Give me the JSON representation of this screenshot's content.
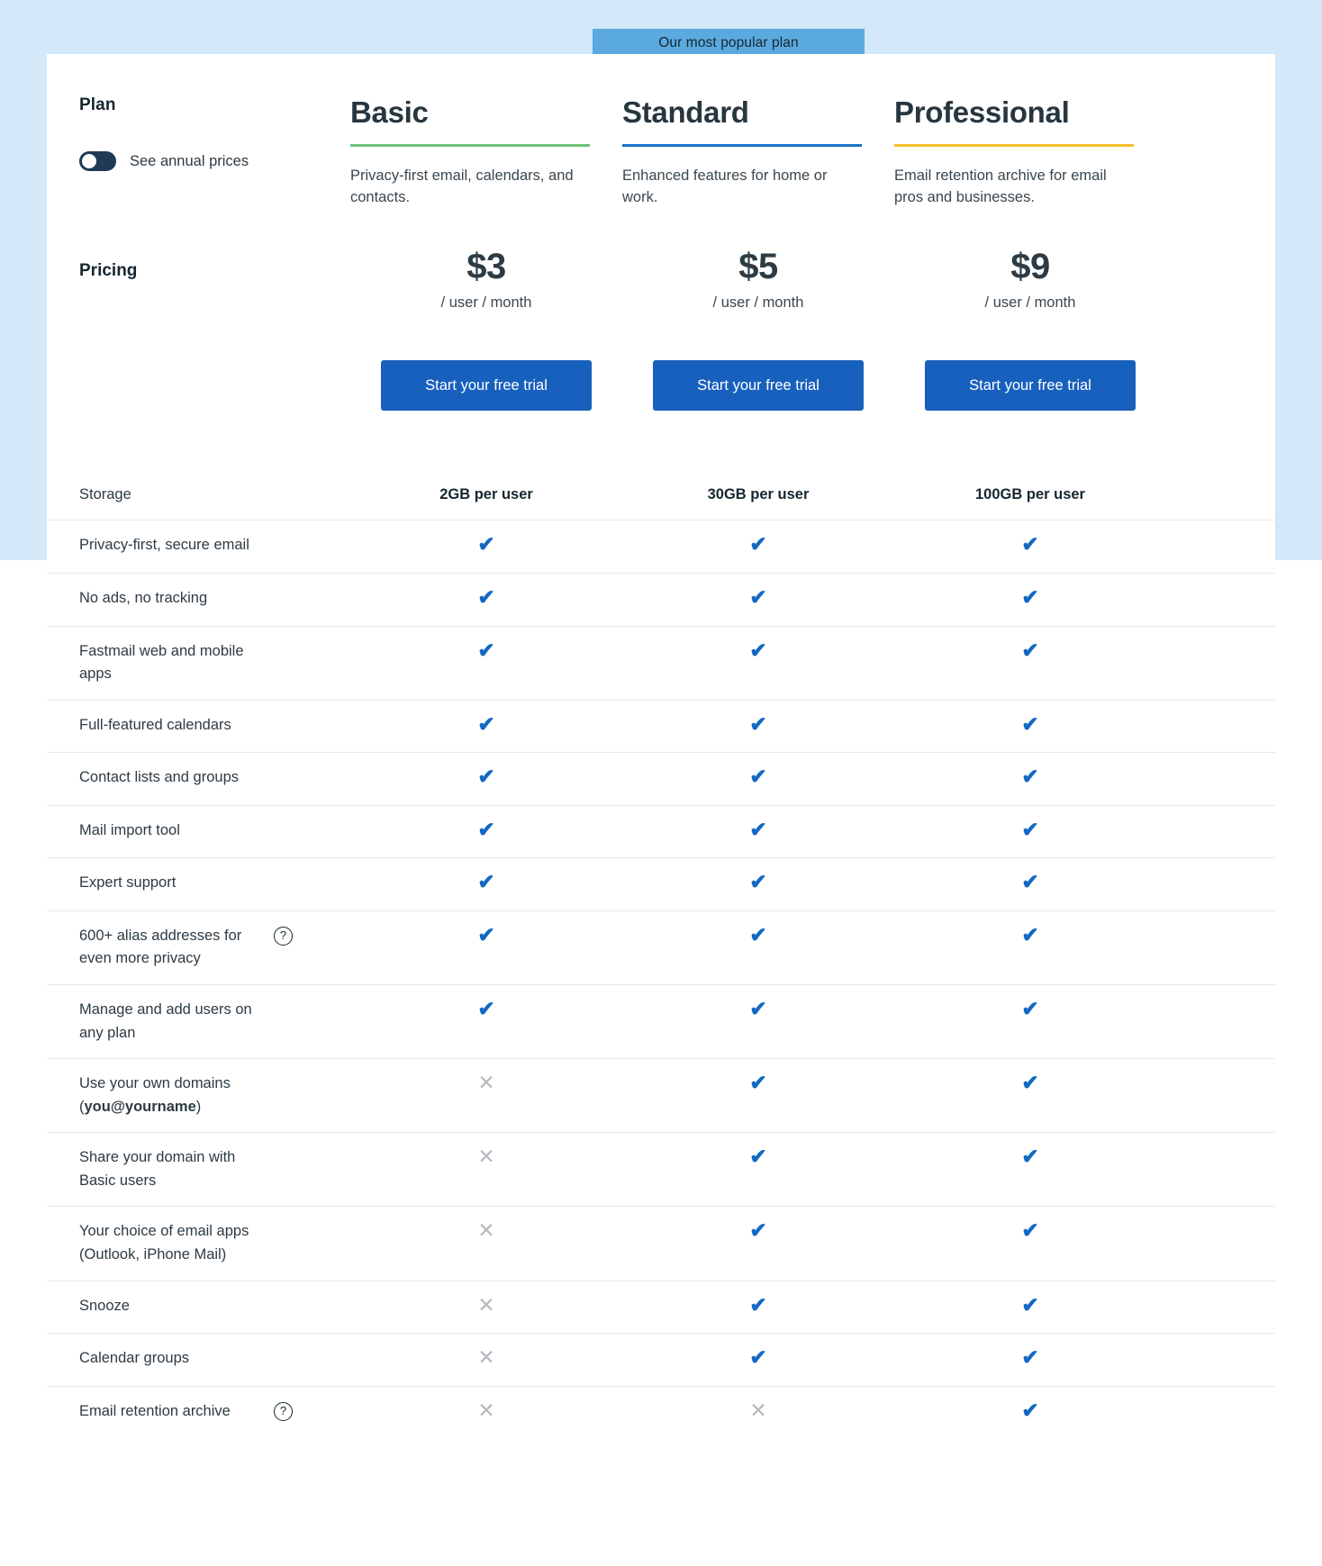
{
  "banner": {
    "text": "Our most popular plan"
  },
  "sidebar": {
    "plan_title": "Plan",
    "toggle_label": "See annual prices",
    "toggle_state": "off",
    "pricing_title": "Pricing"
  },
  "plans": [
    {
      "name": "Basic",
      "accent": "#6ec17a",
      "description": "Privacy-first email, calendars, and contacts.",
      "price": "$3",
      "price_unit": "/ user / month",
      "cta": "Start your free trial",
      "storage": "2GB per user"
    },
    {
      "name": "Standard",
      "accent": "#1a73c7",
      "description": "Enhanced features for home or work.",
      "price": "$5",
      "price_unit": "/ user / month",
      "cta": "Start your free trial",
      "storage": "30GB per user"
    },
    {
      "name": "Professional",
      "accent": "#f5c02b",
      "description": "Email retention archive for email pros and businesses.",
      "price": "$9",
      "price_unit": "/ user / month",
      "cta": "Start your free trial",
      "storage": "100GB per user"
    }
  ],
  "table": {
    "storage_label": "Storage",
    "rows": [
      {
        "label": "Privacy-first, secure email",
        "help": false,
        "values": [
          "check",
          "check",
          "check"
        ]
      },
      {
        "label": "No ads, no tracking",
        "help": false,
        "values": [
          "check",
          "check",
          "check"
        ]
      },
      {
        "label": "Fastmail web and mobile apps",
        "help": false,
        "values": [
          "check",
          "check",
          "check"
        ]
      },
      {
        "label": "Full-featured calendars",
        "help": false,
        "values": [
          "check",
          "check",
          "check"
        ]
      },
      {
        "label": "Contact lists and groups",
        "help": false,
        "values": [
          "check",
          "check",
          "check"
        ]
      },
      {
        "label": "Mail import tool",
        "help": false,
        "values": [
          "check",
          "check",
          "check"
        ]
      },
      {
        "label": "Expert support",
        "help": false,
        "values": [
          "check",
          "check",
          "check"
        ]
      },
      {
        "label": "600+ alias addresses for even more privacy",
        "help": true,
        "values": [
          "check",
          "check",
          "check"
        ]
      },
      {
        "label": "Manage and add users on any plan",
        "help": false,
        "values": [
          "check",
          "check",
          "check"
        ]
      },
      {
        "label": "Use your own domains (you@yourname)",
        "help": false,
        "bold_part": "you@yourname",
        "values": [
          "cross",
          "check",
          "check"
        ]
      },
      {
        "label": "Share your domain with Basic users",
        "help": false,
        "values": [
          "cross",
          "check",
          "check"
        ]
      },
      {
        "label": "Your choice of email apps (Outlook, iPhone Mail)",
        "help": false,
        "values": [
          "cross",
          "check",
          "check"
        ]
      },
      {
        "label": "Snooze",
        "help": false,
        "values": [
          "cross",
          "check",
          "check"
        ]
      },
      {
        "label": "Calendar groups",
        "help": false,
        "values": [
          "cross",
          "check",
          "check"
        ]
      },
      {
        "label": "Email retention archive",
        "help": true,
        "values": [
          "cross",
          "cross",
          "check"
        ]
      }
    ]
  },
  "icons": {
    "check": "✔",
    "cross": "✕",
    "help": "?"
  },
  "colors": {
    "page_band": "#d3e8f8",
    "banner": "#5aaae0",
    "cta": "#1860bd",
    "check": "#1268c3",
    "cross": "#b5bbc0"
  }
}
